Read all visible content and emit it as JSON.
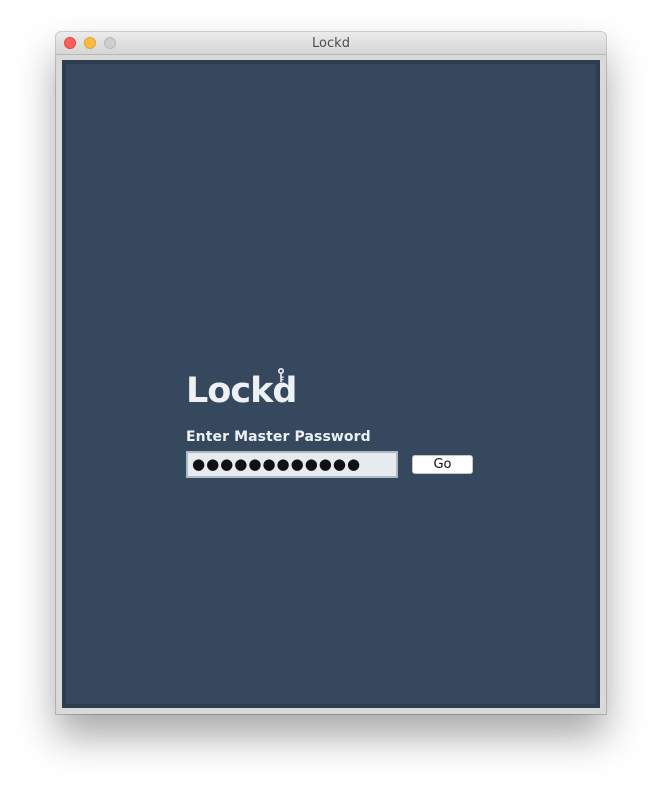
{
  "window": {
    "title": "Lockd"
  },
  "app": {
    "logo_text": "Lockd",
    "prompt_label": "Enter Master Password",
    "password_value": "●●●●●●●●●●●●",
    "go_label": "Go"
  },
  "colors": {
    "background": "#36485d",
    "frame": "#2e3d50",
    "field": "#e6ebf0",
    "text": "#eef1f4"
  },
  "icons": {
    "traffic_close": "close-icon",
    "traffic_minimize": "minimize-icon",
    "traffic_maximize": "maximize-icon",
    "logo_key": "key-icon"
  }
}
